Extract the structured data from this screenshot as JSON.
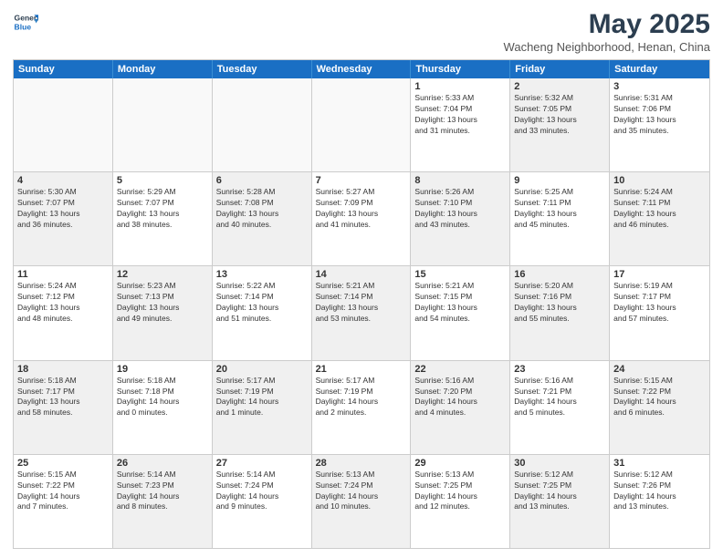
{
  "logo": {
    "line1": "General",
    "line2": "Blue"
  },
  "title": "May 2025",
  "subtitle": "Wacheng Neighborhood, Henan, China",
  "header_days": [
    "Sunday",
    "Monday",
    "Tuesday",
    "Wednesday",
    "Thursday",
    "Friday",
    "Saturday"
  ],
  "weeks": [
    [
      {
        "day": "",
        "info": "",
        "shaded": true
      },
      {
        "day": "",
        "info": "",
        "shaded": true
      },
      {
        "day": "",
        "info": "",
        "shaded": true
      },
      {
        "day": "",
        "info": "",
        "shaded": true
      },
      {
        "day": "1",
        "info": "Sunrise: 5:33 AM\nSunset: 7:04 PM\nDaylight: 13 hours\nand 31 minutes."
      },
      {
        "day": "2",
        "info": "Sunrise: 5:32 AM\nSunset: 7:05 PM\nDaylight: 13 hours\nand 33 minutes.",
        "shaded": true
      },
      {
        "day": "3",
        "info": "Sunrise: 5:31 AM\nSunset: 7:06 PM\nDaylight: 13 hours\nand 35 minutes."
      }
    ],
    [
      {
        "day": "4",
        "info": "Sunrise: 5:30 AM\nSunset: 7:07 PM\nDaylight: 13 hours\nand 36 minutes.",
        "shaded": true
      },
      {
        "day": "5",
        "info": "Sunrise: 5:29 AM\nSunset: 7:07 PM\nDaylight: 13 hours\nand 38 minutes."
      },
      {
        "day": "6",
        "info": "Sunrise: 5:28 AM\nSunset: 7:08 PM\nDaylight: 13 hours\nand 40 minutes.",
        "shaded": true
      },
      {
        "day": "7",
        "info": "Sunrise: 5:27 AM\nSunset: 7:09 PM\nDaylight: 13 hours\nand 41 minutes."
      },
      {
        "day": "8",
        "info": "Sunrise: 5:26 AM\nSunset: 7:10 PM\nDaylight: 13 hours\nand 43 minutes.",
        "shaded": true
      },
      {
        "day": "9",
        "info": "Sunrise: 5:25 AM\nSunset: 7:11 PM\nDaylight: 13 hours\nand 45 minutes."
      },
      {
        "day": "10",
        "info": "Sunrise: 5:24 AM\nSunset: 7:11 PM\nDaylight: 13 hours\nand 46 minutes.",
        "shaded": true
      }
    ],
    [
      {
        "day": "11",
        "info": "Sunrise: 5:24 AM\nSunset: 7:12 PM\nDaylight: 13 hours\nand 48 minutes."
      },
      {
        "day": "12",
        "info": "Sunrise: 5:23 AM\nSunset: 7:13 PM\nDaylight: 13 hours\nand 49 minutes.",
        "shaded": true
      },
      {
        "day": "13",
        "info": "Sunrise: 5:22 AM\nSunset: 7:14 PM\nDaylight: 13 hours\nand 51 minutes."
      },
      {
        "day": "14",
        "info": "Sunrise: 5:21 AM\nSunset: 7:14 PM\nDaylight: 13 hours\nand 53 minutes.",
        "shaded": true
      },
      {
        "day": "15",
        "info": "Sunrise: 5:21 AM\nSunset: 7:15 PM\nDaylight: 13 hours\nand 54 minutes."
      },
      {
        "day": "16",
        "info": "Sunrise: 5:20 AM\nSunset: 7:16 PM\nDaylight: 13 hours\nand 55 minutes.",
        "shaded": true
      },
      {
        "day": "17",
        "info": "Sunrise: 5:19 AM\nSunset: 7:17 PM\nDaylight: 13 hours\nand 57 minutes."
      }
    ],
    [
      {
        "day": "18",
        "info": "Sunrise: 5:18 AM\nSunset: 7:17 PM\nDaylight: 13 hours\nand 58 minutes.",
        "shaded": true
      },
      {
        "day": "19",
        "info": "Sunrise: 5:18 AM\nSunset: 7:18 PM\nDaylight: 14 hours\nand 0 minutes."
      },
      {
        "day": "20",
        "info": "Sunrise: 5:17 AM\nSunset: 7:19 PM\nDaylight: 14 hours\nand 1 minute.",
        "shaded": true
      },
      {
        "day": "21",
        "info": "Sunrise: 5:17 AM\nSunset: 7:19 PM\nDaylight: 14 hours\nand 2 minutes."
      },
      {
        "day": "22",
        "info": "Sunrise: 5:16 AM\nSunset: 7:20 PM\nDaylight: 14 hours\nand 4 minutes.",
        "shaded": true
      },
      {
        "day": "23",
        "info": "Sunrise: 5:16 AM\nSunset: 7:21 PM\nDaylight: 14 hours\nand 5 minutes."
      },
      {
        "day": "24",
        "info": "Sunrise: 5:15 AM\nSunset: 7:22 PM\nDaylight: 14 hours\nand 6 minutes.",
        "shaded": true
      }
    ],
    [
      {
        "day": "25",
        "info": "Sunrise: 5:15 AM\nSunset: 7:22 PM\nDaylight: 14 hours\nand 7 minutes."
      },
      {
        "day": "26",
        "info": "Sunrise: 5:14 AM\nSunset: 7:23 PM\nDaylight: 14 hours\nand 8 minutes.",
        "shaded": true
      },
      {
        "day": "27",
        "info": "Sunrise: 5:14 AM\nSunset: 7:24 PM\nDaylight: 14 hours\nand 9 minutes."
      },
      {
        "day": "28",
        "info": "Sunrise: 5:13 AM\nSunset: 7:24 PM\nDaylight: 14 hours\nand 10 minutes.",
        "shaded": true
      },
      {
        "day": "29",
        "info": "Sunrise: 5:13 AM\nSunset: 7:25 PM\nDaylight: 14 hours\nand 12 minutes."
      },
      {
        "day": "30",
        "info": "Sunrise: 5:12 AM\nSunset: 7:25 PM\nDaylight: 14 hours\nand 13 minutes.",
        "shaded": true
      },
      {
        "day": "31",
        "info": "Sunrise: 5:12 AM\nSunset: 7:26 PM\nDaylight: 14 hours\nand 13 minutes."
      }
    ]
  ]
}
